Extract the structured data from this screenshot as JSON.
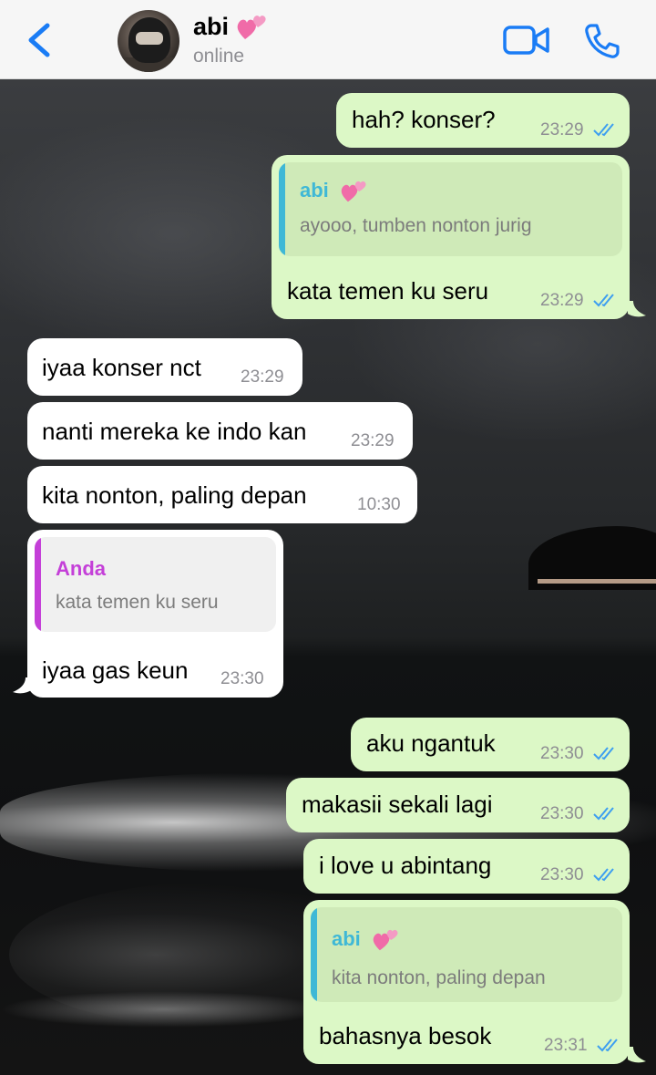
{
  "header": {
    "contact_name": "abi",
    "status": "online",
    "name_emoji": "two-hearts-icon"
  },
  "messages": [
    {
      "dir": "out",
      "text": "hah? konser?",
      "time": "23:29",
      "read": true
    },
    {
      "dir": "out",
      "quote": {
        "name": "abi",
        "text": "ayooo, tumben nonton jurig"
      },
      "text": "kata temen ku seru",
      "time": "23:29",
      "read": true
    },
    {
      "dir": "in",
      "text": "iyaa konser nct",
      "time": "23:29"
    },
    {
      "dir": "in",
      "text": "nanti mereka ke indo kan",
      "time": "23:29"
    },
    {
      "dir": "in",
      "text": "kita nonton, paling depan",
      "time": "10:30"
    },
    {
      "dir": "in",
      "quote": {
        "name": "Anda",
        "text": "kata temen ku seru"
      },
      "text": "iyaa gas keun",
      "time": "23:30"
    },
    {
      "dir": "out",
      "text": "aku ngantuk",
      "time": "23:30",
      "read": true
    },
    {
      "dir": "out",
      "text": "makasii sekali lagi",
      "time": "23:30",
      "read": true
    },
    {
      "dir": "out",
      "text": "i love u abintang",
      "time": "23:30",
      "read": true
    },
    {
      "dir": "out",
      "quote": {
        "name": "abi",
        "text": "kita nonton, paling depan"
      },
      "text": "bahasnya besok",
      "time": "23:31",
      "read": true
    }
  ],
  "colors": {
    "accent": "#1a7cf5",
    "outgoing_bubble": "#dcf8c6",
    "incoming_bubble": "#ffffff",
    "quote_name_contact": "#3fb8d6",
    "quote_name_self": "#c43fd8",
    "read_ticks": "#3d9ef0"
  }
}
